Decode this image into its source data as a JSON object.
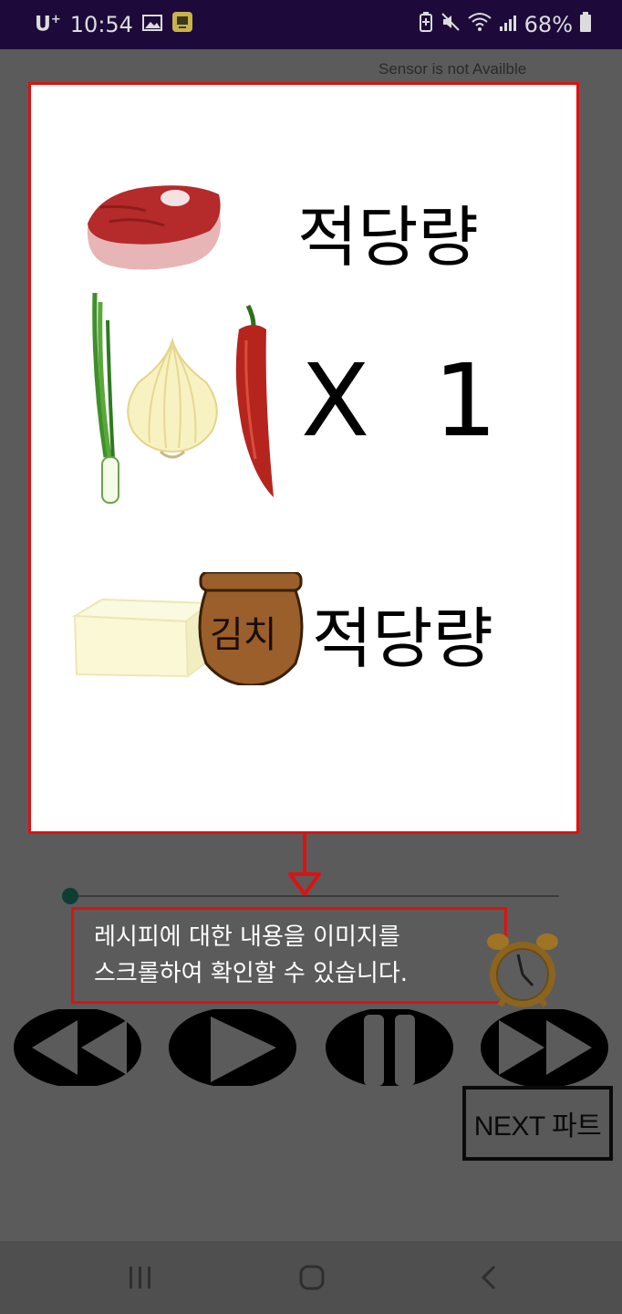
{
  "status_bar": {
    "carrier": "U",
    "carrier_sup": "+",
    "time": "10:54",
    "battery": "68%",
    "icons": [
      "image-icon",
      "app-notification-icon",
      "battery-saver-icon",
      "mute-icon",
      "wifi-icon",
      "signal-icon",
      "battery-icon"
    ]
  },
  "sensor_text": "Sensor is not Availble",
  "recipe_card": {
    "row1_qty": "적당량",
    "row2_qty": "X  1",
    "row3_jar_label": "김치",
    "row3_qty": "적당량",
    "icons": [
      "meat-icon",
      "green-onion-icon",
      "onion-icon",
      "chili-pepper-icon",
      "tofu-icon",
      "kimchi-jar-icon"
    ]
  },
  "seekbar": {
    "progress": 0.0
  },
  "hint": {
    "line1": "레시피에 대한 내용을 이미지를",
    "line2": "스크롤하여 확인할 수 있습니다."
  },
  "controls": {
    "next_part_label": "NEXT 파트",
    "icons": [
      "rewind-icon",
      "play-icon",
      "pause-icon",
      "fast-forward-icon",
      "alarm-clock-icon"
    ]
  },
  "nav_bar": {
    "icons": [
      "recent-apps-icon",
      "home-icon",
      "back-icon"
    ]
  },
  "colors": {
    "status_bar": "#1d0a3a",
    "highlight": "#e01010",
    "app_bg": "#5b5b5b"
  }
}
